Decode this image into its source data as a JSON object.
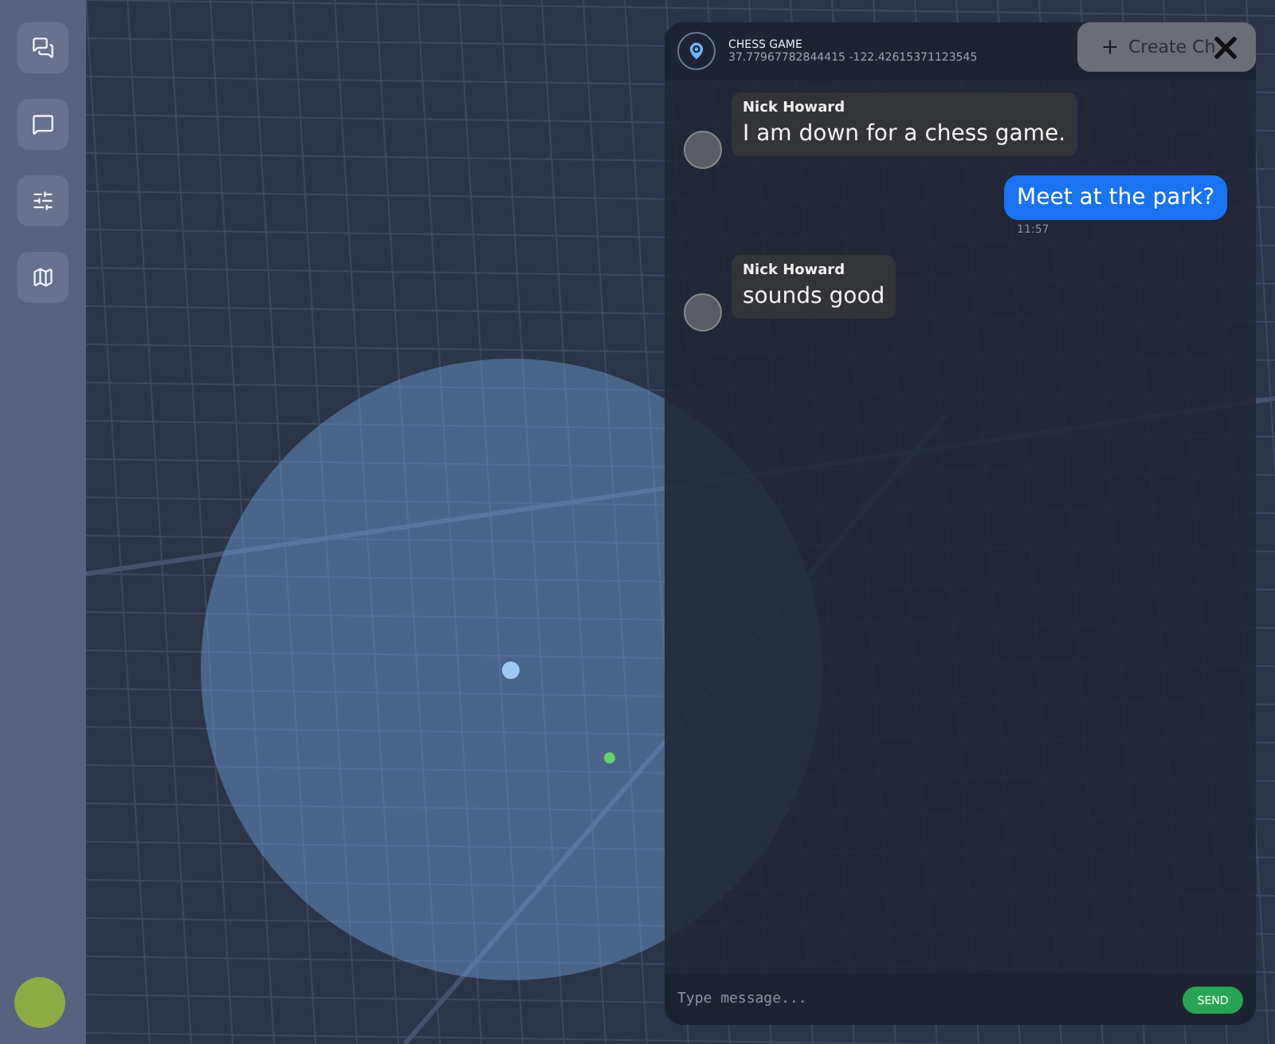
{
  "sidebar": {
    "items": [
      {
        "kind": "chats",
        "selected": false
      },
      {
        "kind": "message",
        "selected": false
      },
      {
        "kind": "filters",
        "selected": false
      },
      {
        "kind": "map",
        "selected": false
      }
    ]
  },
  "chat": {
    "title": "CHESS GAME",
    "coordinates": "37.77967782844415 -122.42615371123545",
    "messages": [
      {
        "kind": "incoming",
        "sender": "Nick Howard",
        "text": "I am down for a chess game."
      },
      {
        "kind": "outgoing",
        "text": "Meet at the park?",
        "time": "11:57"
      },
      {
        "kind": "incoming",
        "sender": "Nick Howard",
        "text": "sounds good"
      }
    ],
    "input": {
      "placeholder": "Type message..."
    },
    "send_button": "SEND"
  },
  "create_button": "Create Ch"
}
